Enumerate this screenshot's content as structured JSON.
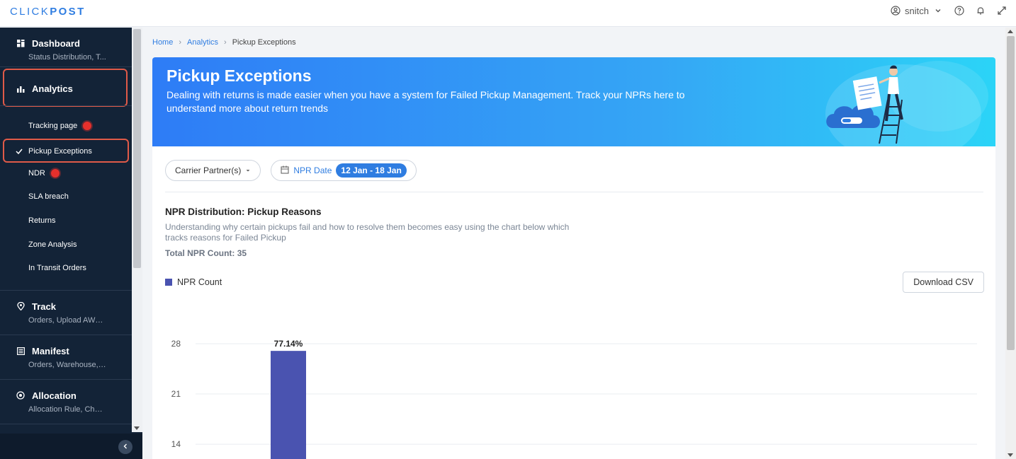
{
  "brand": {
    "logo_light": "CLICK",
    "logo_bold": "POST"
  },
  "topbar": {
    "username": "snitch"
  },
  "sidebar": {
    "sections": [
      {
        "title": "Dashboard",
        "subtitle": "Status Distribution, T..."
      },
      {
        "title": "Analytics",
        "subtitle": ""
      },
      {
        "title": "Track",
        "subtitle": "Orders, Upload AWB ..."
      },
      {
        "title": "Manifest",
        "subtitle": "Orders, Warehouse, ..."
      },
      {
        "title": "Allocation",
        "subtitle": "Allocation Rule, Chec..."
      }
    ],
    "analytics_items": [
      {
        "label": "Tracking page",
        "badge": true
      },
      {
        "label": "Pickup Exceptions",
        "active": true
      },
      {
        "label": "NDR",
        "badge": true
      },
      {
        "label": "SLA breach"
      },
      {
        "label": "Returns"
      },
      {
        "label": "Zone Analysis"
      },
      {
        "label": "In Transit Orders"
      }
    ],
    "collapse_icon": "chevron-left-icon"
  },
  "breadcrumb": {
    "home": "Home",
    "analytics": "Analytics",
    "current": "Pickup Exceptions"
  },
  "banner": {
    "title": "Pickup Exceptions",
    "description": "Dealing with returns is made easier when you have a system for Failed Pickup Management. Track your NPRs here to understand more about return trends"
  },
  "filters": {
    "carrier_label": "Carrier Partner(s)",
    "date_label": "NPR Date",
    "date_range": "12 Jan - 18 Jan"
  },
  "section": {
    "title": "NPR Distribution: Pickup Reasons",
    "description": "Understanding why certain pickups fail and how to resolve them becomes easy using the chart below which tracks reasons for Failed Pickup",
    "total_label": "Total NPR Count: 35"
  },
  "download_label": "Download CSV",
  "colors": {
    "accent": "#2f7de1",
    "bar": "#4a53b0",
    "sidebar_bg": "#132337",
    "highlight": "#e05a48"
  },
  "chart_data": {
    "type": "bar",
    "series": [
      {
        "name": "NPR Count",
        "values": [
          27
        ]
      }
    ],
    "data_labels": [
      "77.14%"
    ],
    "y_ticks": [
      14,
      21,
      28
    ],
    "ylim": [
      0,
      28
    ],
    "grid": true,
    "legend": "top-left"
  }
}
